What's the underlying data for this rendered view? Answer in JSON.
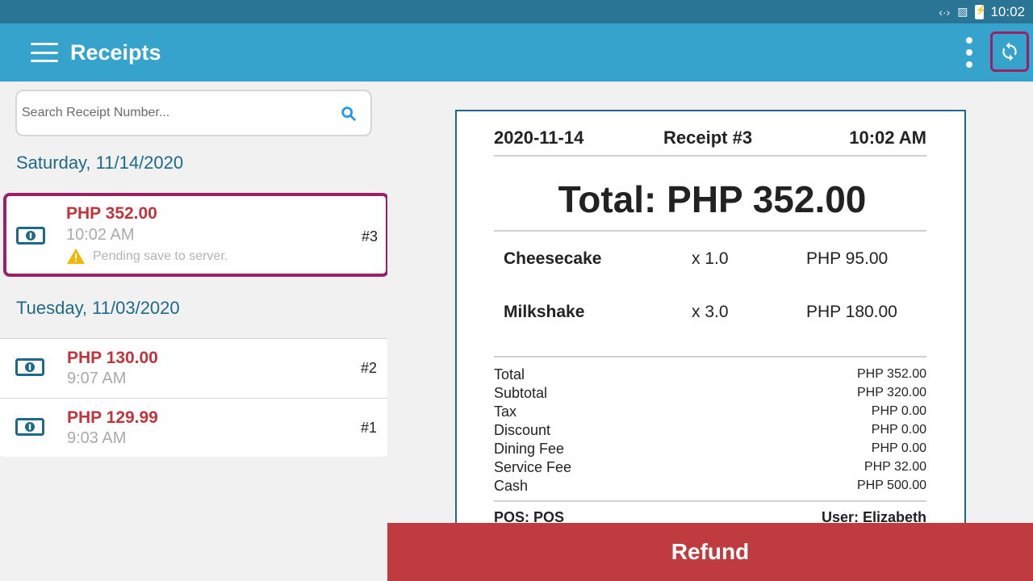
{
  "status_bar": {
    "time": "10:02",
    "icons": [
      "code-icon",
      "no-sim-icon",
      "battery-charging-icon"
    ]
  },
  "app_bar": {
    "title": "Receipts",
    "menu_icon": "hamburger-icon",
    "overflow_icon": "more-vert-icon",
    "sync_icon": "sync-icon"
  },
  "search": {
    "placeholder": "Search Receipt Number...",
    "value": ""
  },
  "groups": [
    {
      "date": "Saturday, 11/14/2020",
      "receipts": [
        {
          "amount": "PHP 352.00",
          "time": "10:02 AM",
          "number": "#3",
          "status": "Pending save to server.",
          "selected": true
        }
      ]
    },
    {
      "date": "Tuesday, 11/03/2020",
      "receipts": [
        {
          "amount": "PHP 130.00",
          "time": "9:07 AM",
          "number": "#2"
        },
        {
          "amount": "PHP 129.99",
          "time": "9:03 AM",
          "number": "#1"
        }
      ]
    }
  ],
  "receipt": {
    "date": "2020-11-14",
    "title": "Receipt #3",
    "time": "10:02 AM",
    "total": "Total: PHP 352.00",
    "items": [
      {
        "name": "Cheesecake",
        "qty": "x 1.0",
        "price": "PHP 95.00"
      },
      {
        "name": "Milkshake",
        "qty": "x 3.0",
        "price": "PHP 180.00"
      }
    ],
    "summary": [
      {
        "label": "Total",
        "value": "PHP 352.00"
      },
      {
        "label": "Subtotal",
        "value": "PHP 320.00"
      },
      {
        "label": "Tax",
        "value": "PHP 0.00"
      },
      {
        "label": "Discount",
        "value": "PHP 0.00"
      },
      {
        "label": "Dining Fee",
        "value": "PHP 0.00"
      },
      {
        "label": "Service Fee",
        "value": "PHP 32.00"
      },
      {
        "label": "Cash",
        "value": "PHP 500.00"
      }
    ],
    "pos": "POS: POS",
    "user": "User: Elizabeth"
  },
  "refund_label": "Refund",
  "colors": {
    "app_bar": "#35a3cb",
    "status_bar": "#2a7496",
    "amount": "#c0343c",
    "highlight": "#9b2067",
    "refund": "#bf3b40",
    "date_header": "#1e6a86"
  }
}
